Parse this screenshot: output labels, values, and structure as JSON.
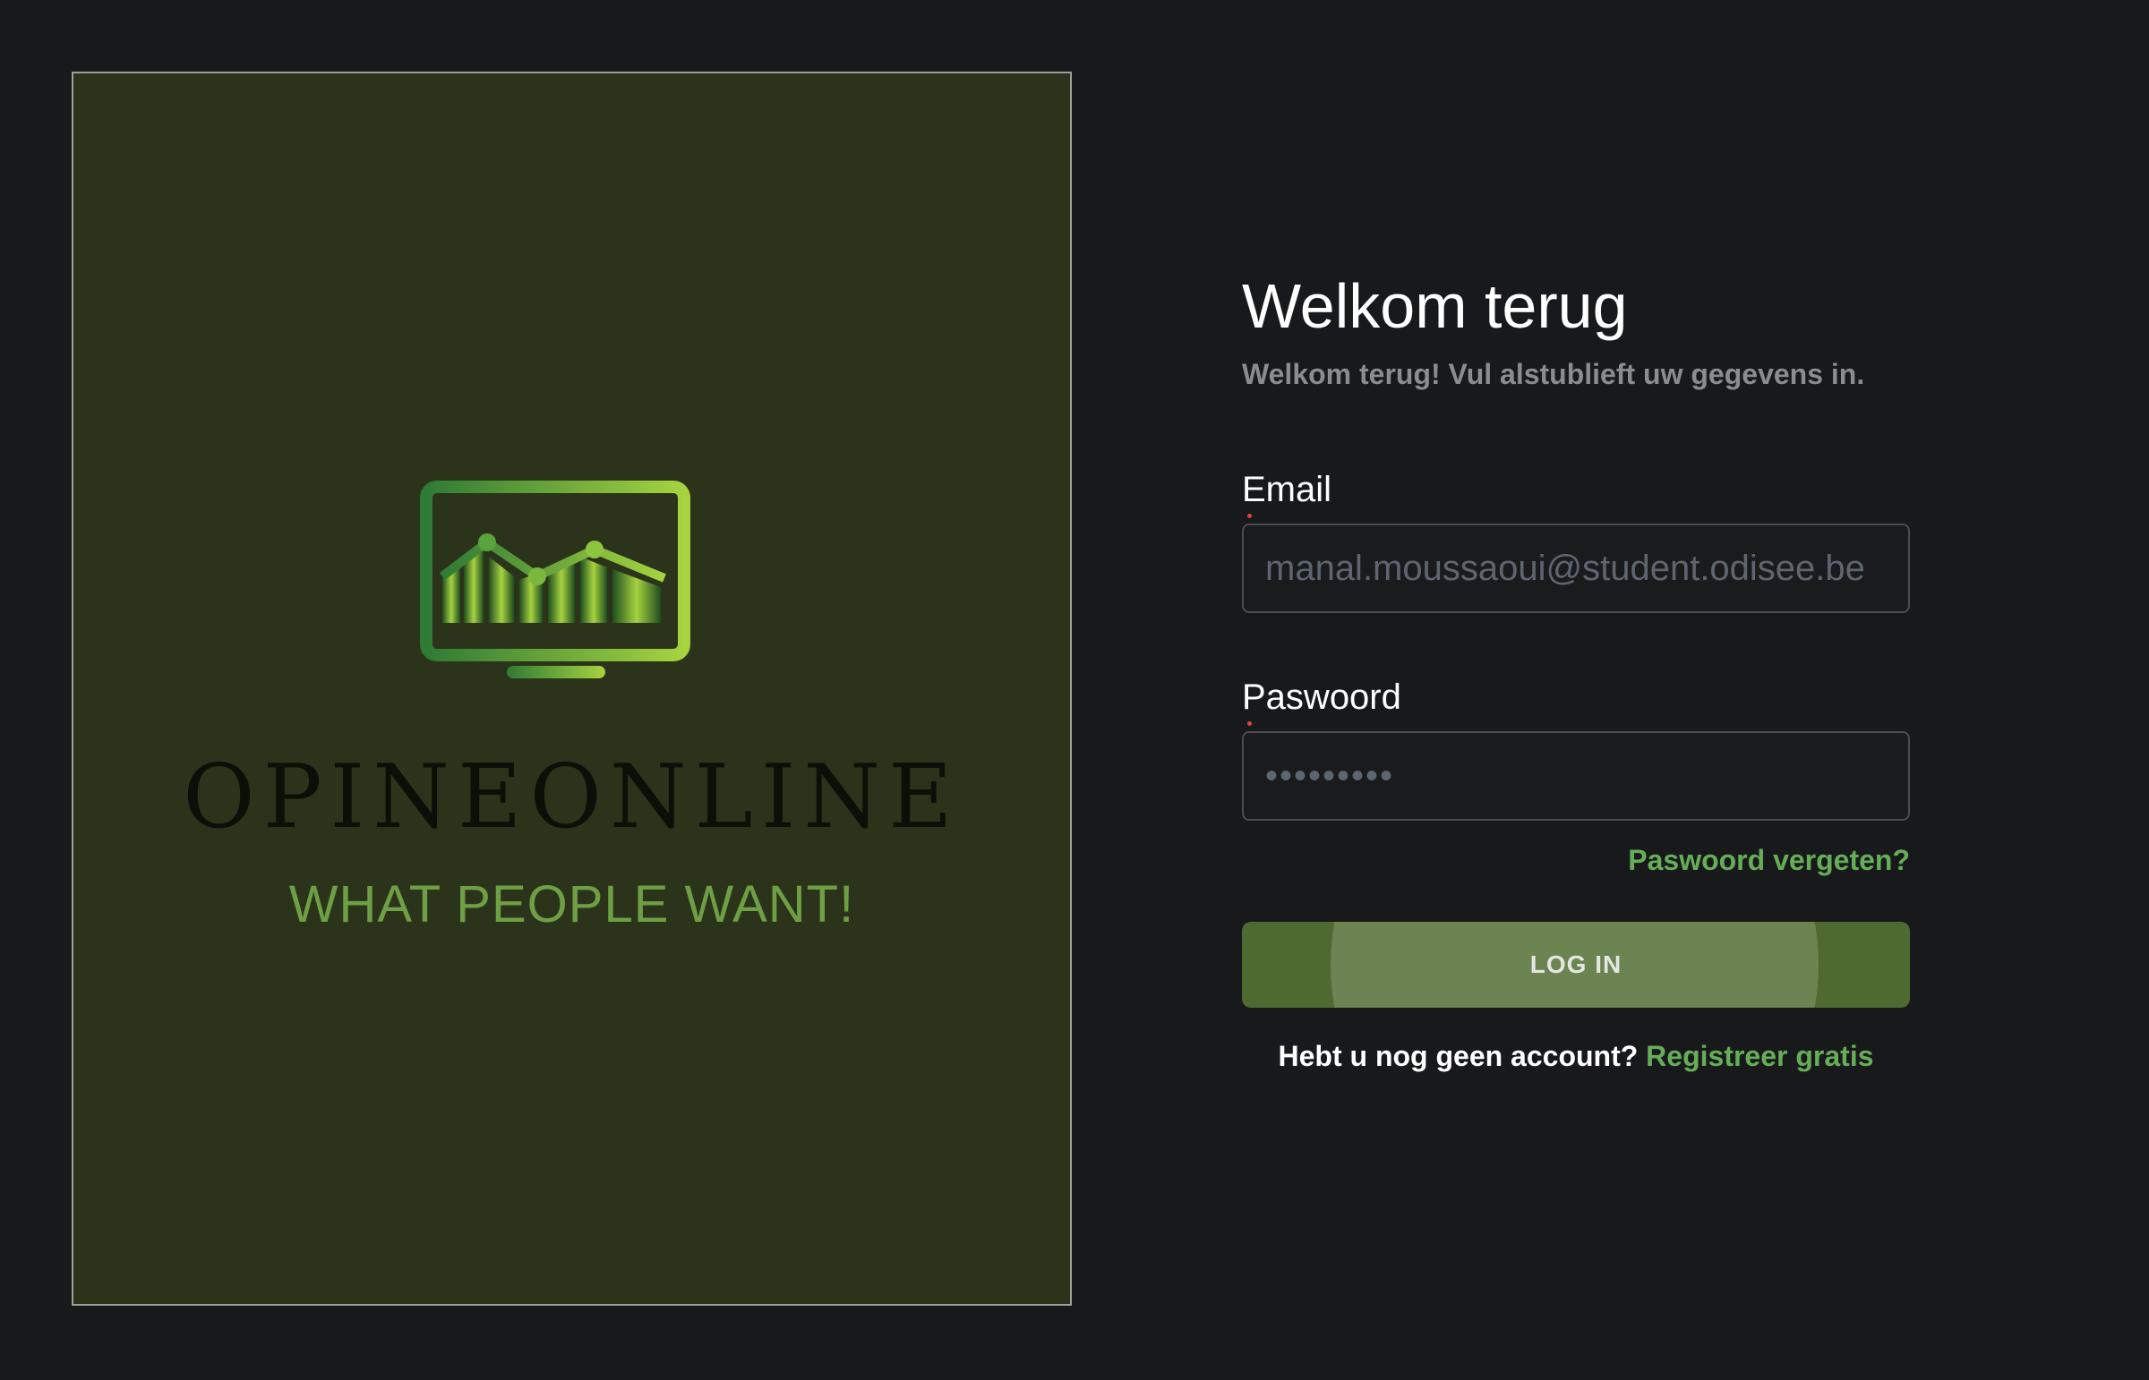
{
  "brand": {
    "logo_icon": "monitor-chart-icon",
    "wordmark": "OPINEONLINE",
    "tagline": "WHAT PEOPLE WANT!",
    "colors": {
      "panel_background": "#2b341a",
      "logo_green_dark": "#2f7a35",
      "logo_green_light": "#a6d33f"
    }
  },
  "login": {
    "title": "Welkom terug",
    "subtitle": "Welkom terug! Vul alstublieft uw gegevens in.",
    "email_label": "Email",
    "email_placeholder": "manal.moussaoui@student.odisee.be",
    "email_value": "",
    "password_label": "Paswoord",
    "password_placeholder": "•••••••••",
    "password_value": "",
    "forgot_password": "Paswoord vergeten?",
    "login_button": "LOG IN",
    "no_account_text": "Hebt u nog geen account?",
    "register_link": "Registreer gratis"
  },
  "theme": {
    "page_background": "#18191b",
    "accent_green": "#66ad58",
    "button_green": "#4f6a30",
    "required_marker": "#d9483b"
  }
}
